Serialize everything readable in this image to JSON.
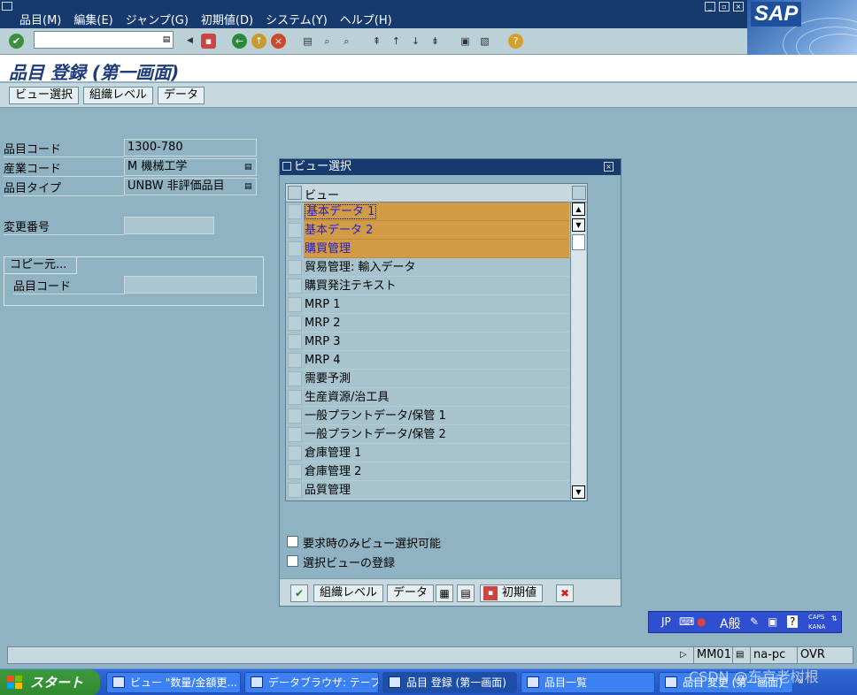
{
  "menubar": {
    "items": [
      "品目(M)",
      "編集(E)",
      "ジャンプ(G)",
      "初期値(D)",
      "システム(Y)",
      "ヘルプ(H)"
    ],
    "logo": "SAP"
  },
  "toolbar": {
    "command_value": "",
    "icons": [
      "enter-icon",
      "back-icon",
      "save-icon",
      "back-arrow-icon",
      "exit-icon",
      "cancel-icon",
      "print-icon",
      "find-icon",
      "find-next-icon",
      "first-page-icon",
      "prev-page-icon",
      "next-page-icon",
      "last-page-icon",
      "create-session-icon",
      "shortcut-icon",
      "help-icon"
    ]
  },
  "title": "品目 登録 (第一画面)",
  "app_toolbar": {
    "buttons": [
      "ビュー選択",
      "組織レベル",
      "データ"
    ]
  },
  "form": {
    "material_label": "品目コード",
    "material_value": "1300-780",
    "industry_label": "産業コード",
    "industry_value": "M 機械工学",
    "type_label": "品目タイプ",
    "type_value": "UNBW 非評価品目",
    "change_label": "変更番号",
    "change_value": "",
    "copy_tab": "コピー元...",
    "copy_material_label": "品目コード",
    "copy_material_value": ""
  },
  "dialog": {
    "title": "ビュー選択",
    "column_header": "ビュー",
    "rows": [
      {
        "label": "基本データ 1",
        "selected": true
      },
      {
        "label": "基本データ 2",
        "selected": true
      },
      {
        "label": "購買管理",
        "selected": true
      },
      {
        "label": "貿易管理: 輸入データ",
        "selected": false
      },
      {
        "label": "購買発注テキスト",
        "selected": false
      },
      {
        "label": "MRP 1",
        "selected": false
      },
      {
        "label": "MRP 2",
        "selected": false
      },
      {
        "label": "MRP 3",
        "selected": false
      },
      {
        "label": "MRP 4",
        "selected": false
      },
      {
        "label": "需要予測",
        "selected": false
      },
      {
        "label": "生産資源/治工具",
        "selected": false
      },
      {
        "label": "一般プラントデータ/保管 1",
        "selected": false
      },
      {
        "label": "一般プラントデータ/保管 2",
        "selected": false
      },
      {
        "label": "倉庫管理 1",
        "selected": false
      },
      {
        "label": "倉庫管理 2",
        "selected": false
      },
      {
        "label": "品質管理",
        "selected": false
      }
    ],
    "option1": "要求時のみビュー選択可能",
    "option2": "選択ビューの登録",
    "buttons": {
      "org_levels": "組織レベル",
      "data": "データ",
      "defaults": "初期値"
    }
  },
  "statusbar": {
    "transaction": "MM01",
    "server": "na-pc",
    "mode": "OVR"
  },
  "imebar": {
    "lang": "JP",
    "mode": "A般",
    "caps": "CAPS",
    "kana": "KANA"
  },
  "taskbar": {
    "start": "スタート",
    "tasks": [
      "ビュー \"数量/金額更...",
      "データブラウザ: テーブ...",
      "品目 登録 (第一画面)",
      "品目一覧",
      "品目 変更 (第一画面)"
    ]
  },
  "watermark": "CSDN @东京老树根",
  "colors": {
    "background": "#8fb3c2",
    "menubar": "#163a6e",
    "selected_row": "#d39b46",
    "selected_text": "#1c1cd8",
    "title_text": "#1e3c78"
  }
}
